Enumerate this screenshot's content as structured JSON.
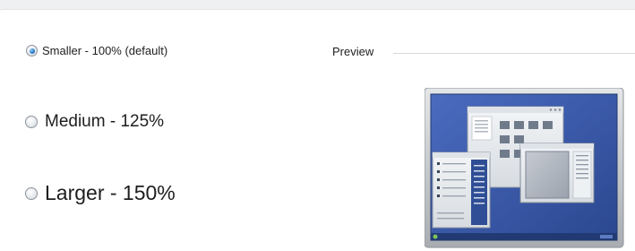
{
  "options": [
    {
      "label": "Smaller - 100% (default)",
      "selected": true
    },
    {
      "label": "Medium - 125%",
      "selected": false
    },
    {
      "label": "Larger - 150%",
      "selected": false
    }
  ],
  "preview": {
    "title": "Preview",
    "icon": "desktop-preview-icon",
    "colors": {
      "desktop": "#3a59a8",
      "frame": "#c9cbcd",
      "window": "#e8ebee"
    }
  }
}
